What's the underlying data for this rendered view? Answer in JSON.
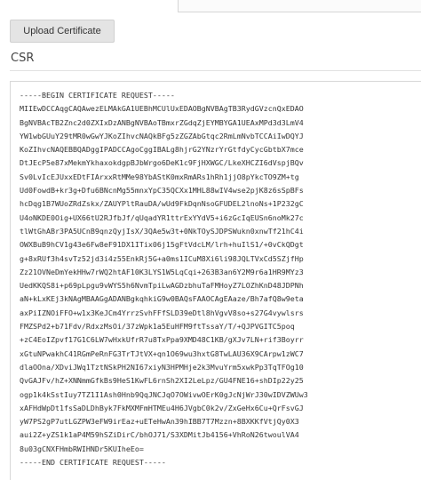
{
  "upload_button": {
    "label": "Upload Certificate"
  },
  "csr": {
    "title": "CSR",
    "text": "-----BEGIN CERTIFICATE REQUEST-----\nMIIEwDCCAqgCAQAwezELMAkGA1UEBhMCUlUxEDAOBgNVBAgTB3RydGVzcnQxEDAO\nBgNVBAcTB2Znc2d0ZXIxDzANBgNVBAoTBmxrZGdqZjEYMBYGA1UEAxMPd3d3LmV4\nYW1wbGUuY29tMR0wGwYJKoZIhvcNAQkBFg5zZGZAbGtqc2RmLmNvbTCCAiIwDQYJ\nKoZIhvcNAQEBBQADggIPADCCAgoCggIBALg8hjrG2YNzrYrGtfdyCycGbtbX7mce\nDtJEcP5e87xMekmYkhaxokdgpBJbWrgo6DeK1c9FjHXWGC/LkeXHCZI6dVspjBQv\nSv0LvIcEJUxxEDtFIArxxRtMMe98YbAStK0mxRmARs1hRh1jjO8pYkcTO9ZM+tg\nUd0FowdB+kr3g+Dfu6BNcnMg55mnxYpC35QCXx1MHL88wIV4wse2pjK8z6sSpBFs\nhcDqg1B7WUoZRdZskx/ZAUYPltRauDA/wUd9FkDqnNsoGFUDEL2lnoNs+1P232gC\nU4oNKDE0Oig+UX66tU2RJfbJf/qUqadYR1ttrExYYdV5+i6zGcIqEUSn6noMk27c\ntlWtGhABr3PA5UCnB9qnzQyjIsX/3QAe5w3t+0NkTOySJDPSWukn0xnwTf21hC4i\nOWXBuB9hCV1g43e6Fw8eF91DX1ITix06j15gFtVdcLM/lrh+huIlS1/+0vCkQDgt\ng+8xRUf3h4svTz52jd3i4z55EnkRj5G+a0ms1ICuM8Xi6li98JQLTVxCd5SZjfHp\nZz21OVNeDmYekHHw7rWQ2htAF10K3LYS1W5LqCqi+263B3an6Y2M9r6a1HR9MYz3\nUedKKQS8i+p69pLpgu9vWYS5h6NvmTpiLwAGDzbhuTaFMHoyZ7LOZhKnD48JDPNh\naN+kLxKEj3kNAgMBAAGgADANBgkqhkiG9w0BAQsFAAOCAgEAaze/Bh7afQ8w9eta\naxPiIZNOiFFO+w1x3KeJCm4YrrzSvhFFfSLD39eDtl8hVgvV8so+s27G4vywlsrs\nFMZSPd2+b71Fdv/RdxzMsOi/37zWpk1a5EuHFM9ftTssaY/T/+QJPVGITC5poq\n+zC4EoIZpvf17G1C6LW7wHxkUfrR7u8TxPpa9XMD48C1KB/gXJv7LN+rif3Boyrr\nxGtuNPwakhC41RGmPeRnFG3TrTJtVX+qn1O69wu3hxtG8TwLAU36X9CArpw1zWC7\ndlaOOna/XDviJWq1TztNSkPH2NI67xiyN3HPMHje2k3MvuYrm5xwkPp3TqTFOg10\nQvGAJFv/hZ+XNNmmGfkBs9HeS1KwFL6rnSh2XI2LeLpz/GU4FNE16+shDIp22y25\nogp1k4kSstIuy7TZ1I1Ash0Hnb9QqJNCJqO7OWivwOErK0gJcNjWrJ30wIDVZWUw3\nxAFHdWpDt1fsSaDLDhByk7FkMXMFmHTMEu4H6JVgbC0k2v/ZxGeHx6Cu+QrFsvGJ\nyW7PS2gP7utLGZPW3eFW9irEaz+uETeHwAn39hIBB7T7Mzzn+8BXKKfVtjQy0X3\naui2Z+yZS1k1aP4M59hSZiDirC/bhOJ71/S3XDMitJb4156+VhRoN26twoulVA4\n8u03gCNXFHmbRWIHNDr5KUIheEo=\n-----END CERTIFICATE REQUEST-----"
  }
}
